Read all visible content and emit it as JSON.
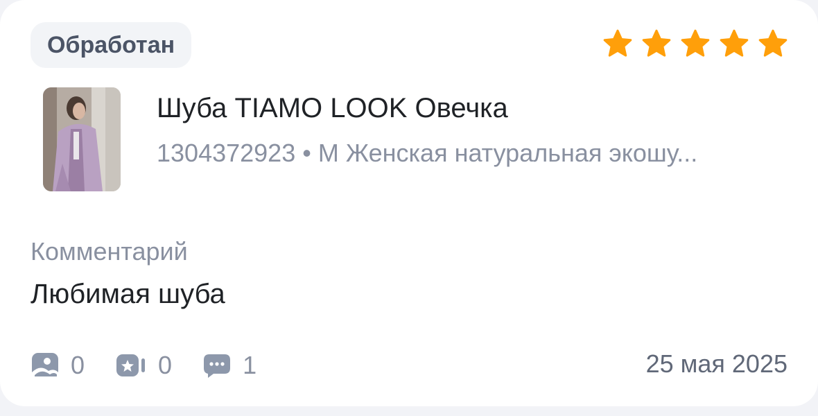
{
  "review": {
    "status": "Обработан",
    "rating": 5,
    "rating_max": 5,
    "star_color": "#ff9f0a",
    "product": {
      "title": "Шуба TIAMO LOOK Овечка",
      "subtitle": "1304372923 • M Женская натуральная экошу..."
    },
    "comment": {
      "label": "Комментарий",
      "text": "Любимая шуба"
    },
    "stats": {
      "photos": "0",
      "videos": "0",
      "comments": "1"
    },
    "date": "25 мая 2025"
  },
  "icons": {
    "stars": "star-icon",
    "photos": "photo-icon",
    "videos": "video-camera-icon",
    "comments": "chat-bubble-icon"
  }
}
